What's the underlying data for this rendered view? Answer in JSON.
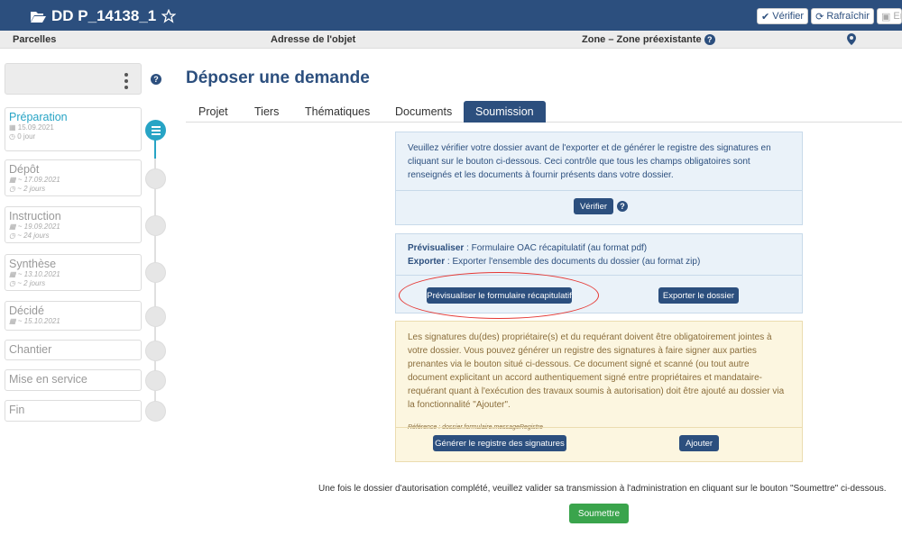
{
  "header": {
    "title": "DD P_14138_1",
    "buttons": {
      "verify": "Vérifier",
      "refresh": "Rafraîchir",
      "save": "En"
    }
  },
  "infobar": {
    "parcels": "Parcelles",
    "address": "Adresse de l'objet",
    "zone": "Zone – Zone préexistante"
  },
  "sidebar": {
    "steps": [
      {
        "label": "Préparation",
        "date": "15.09.2021",
        "duration": "0 jour"
      },
      {
        "label": "Dépôt",
        "date": "~ 17.09.2021",
        "duration": "~ 2 jours"
      },
      {
        "label": "Instruction",
        "date": "~ 19.09.2021",
        "duration": "~ 24 jours"
      },
      {
        "label": "Synthèse",
        "date": "~ 13.10.2021",
        "duration": "~ 2 jours"
      },
      {
        "label": "Décidé",
        "date": "~ 15.10.2021"
      },
      {
        "label": "Chantier"
      },
      {
        "label": "Mise en service"
      },
      {
        "label": "Fin"
      }
    ]
  },
  "main": {
    "title": "Déposer une demande",
    "tabs": [
      "Projet",
      "Tiers",
      "Thématiques",
      "Documents",
      "Soumission"
    ],
    "panel1": {
      "text": "Veuillez vérifier votre dossier avant de l'exporter et de générer le registre des signatures en cliquant sur le bouton ci-dessous. Ceci contrôle que tous les champs obligatoires sont renseignés et les documents à fournir présents dans votre dossier.",
      "button": "Vérifier"
    },
    "panel2": {
      "preview_label": "Prévisualiser",
      "preview_text": " : Formulaire OAC récapitulatif (au format pdf)",
      "export_label": "Exporter",
      "export_text": " : Exporter l'ensemble des documents du dossier (au format zip)",
      "preview_button": "Prévisualiser le formulaire récapitulatif",
      "export_button": "Exporter le dossier"
    },
    "panel3": {
      "text": "Les signatures du(des) propriétaire(s) et du requérant doivent être obligatoirement jointes à votre dossier. Vous pouvez générer un registre des signatures à faire signer aux parties prenantes via le bouton situé ci-dessous. Ce document signé et scanné (ou tout autre document explicitant un accord authentiquement signé entre propriétaires et mandataire-requérant quant à l'exécution des travaux soumis à autorisation) doit être ajouté au dossier via la fonctionnalité \"Ajouter\".",
      "reference": "Référence : dossier.formulaire.messageRegistre",
      "generate_button": "Générer le registre des signatures",
      "add_button": "Ajouter"
    },
    "footer_text": "Une fois le dossier d'autorisation complété, veuillez valider sa transmission à l'administration en cliquant sur le bouton \"Soumettre\" ci-dessous.",
    "submit_button": "Soumettre"
  },
  "colors": {
    "primary": "#2c4f7e",
    "accent": "#27a4c5",
    "success": "#3aa44c",
    "annotation": "#e53935"
  }
}
